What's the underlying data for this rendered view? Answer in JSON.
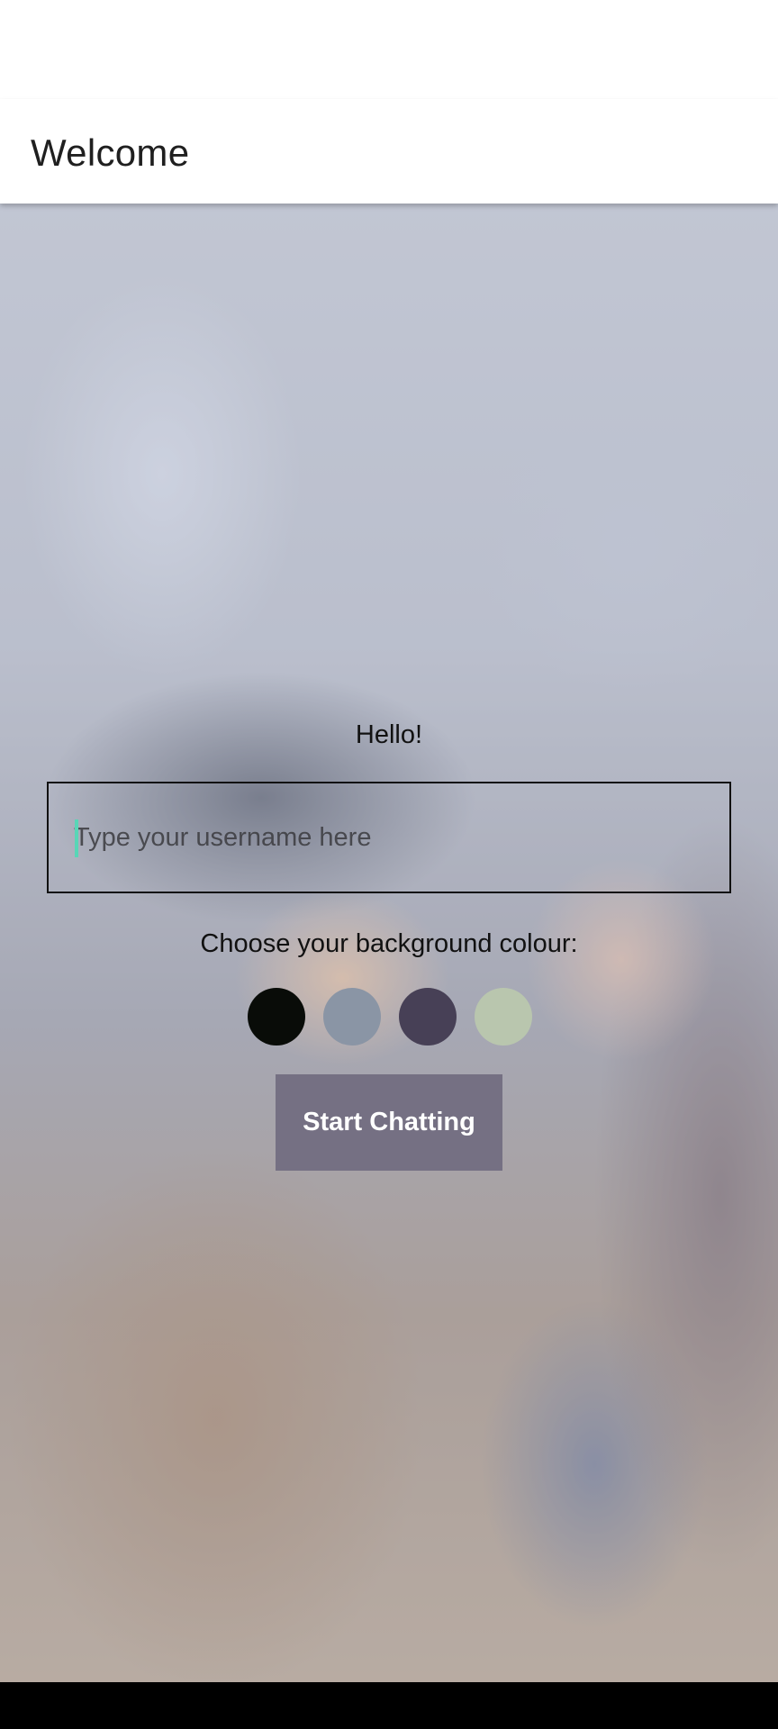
{
  "app_bar": {
    "title": "Welcome"
  },
  "start_screen": {
    "greeting": "Hello!",
    "username_input": {
      "value": "",
      "placeholder": "Type your username here"
    },
    "color_prompt": "Choose your background colour:",
    "color_options": [
      {
        "name": "black",
        "hex": "#090C08"
      },
      {
        "name": "gray-blue",
        "hex": "#8A95A5"
      },
      {
        "name": "dark-purple",
        "hex": "#474056"
      },
      {
        "name": "sage-green",
        "hex": "#B9C6AE"
      }
    ],
    "start_button_label": "Start Chatting",
    "start_button_color": "#757083",
    "caret_color": "#58D6B6"
  }
}
